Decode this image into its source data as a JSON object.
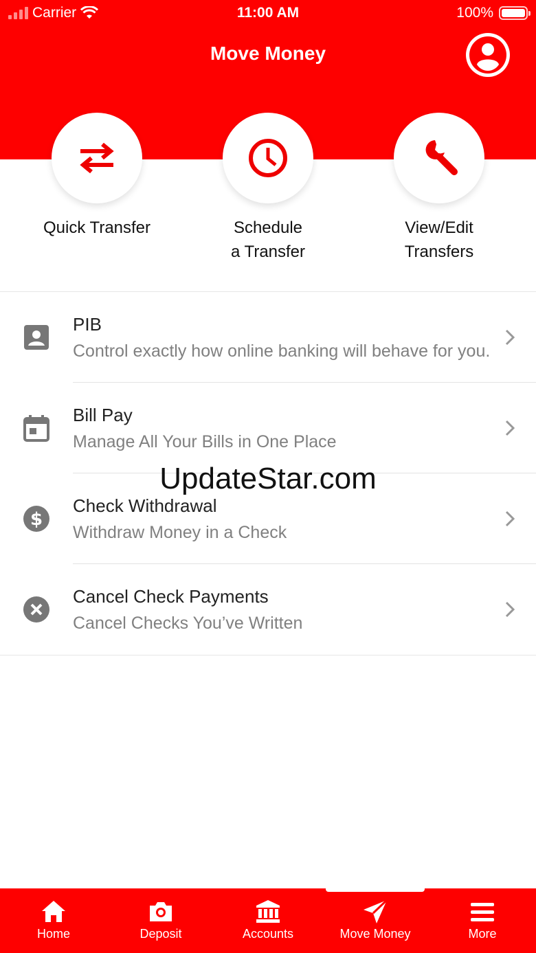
{
  "status_bar": {
    "carrier": "Carrier",
    "time": "11:00 AM",
    "battery": "100%"
  },
  "header": {
    "title": "Move Money"
  },
  "actions": [
    {
      "label": "Quick Transfer",
      "icon": "swap-arrows-icon"
    },
    {
      "label": "Schedule\na Transfer",
      "icon": "clock-icon"
    },
    {
      "label": "View/Edit\nTransfers",
      "icon": "wrench-icon"
    }
  ],
  "list": [
    {
      "title": "PIB",
      "subtitle": "Control exactly how online banking will behave for you.",
      "icon": "account-box-icon"
    },
    {
      "title": "Bill Pay",
      "subtitle": "Manage All Your Bills in One Place",
      "icon": "calendar-icon"
    },
    {
      "title": "Check Withdrawal",
      "subtitle": "Withdraw Money in a Check",
      "icon": "dollar-circle-icon"
    },
    {
      "title": "Cancel Check Payments",
      "subtitle": "Cancel Checks You’ve Written",
      "icon": "cancel-circle-icon"
    }
  ],
  "watermark": "UpdateStar.com",
  "tabbar": {
    "items": [
      {
        "label": "Home",
        "icon": "home-icon"
      },
      {
        "label": "Deposit",
        "icon": "camera-icon"
      },
      {
        "label": "Accounts",
        "icon": "bank-icon"
      },
      {
        "label": "Move Money",
        "icon": "paper-plane-icon",
        "active": true
      },
      {
        "label": "More",
        "icon": "menu-icon"
      }
    ]
  },
  "colors": {
    "brand": "#fe0000",
    "text": "#222222",
    "subtext": "#808080",
    "icon_gray": "#777777"
  }
}
